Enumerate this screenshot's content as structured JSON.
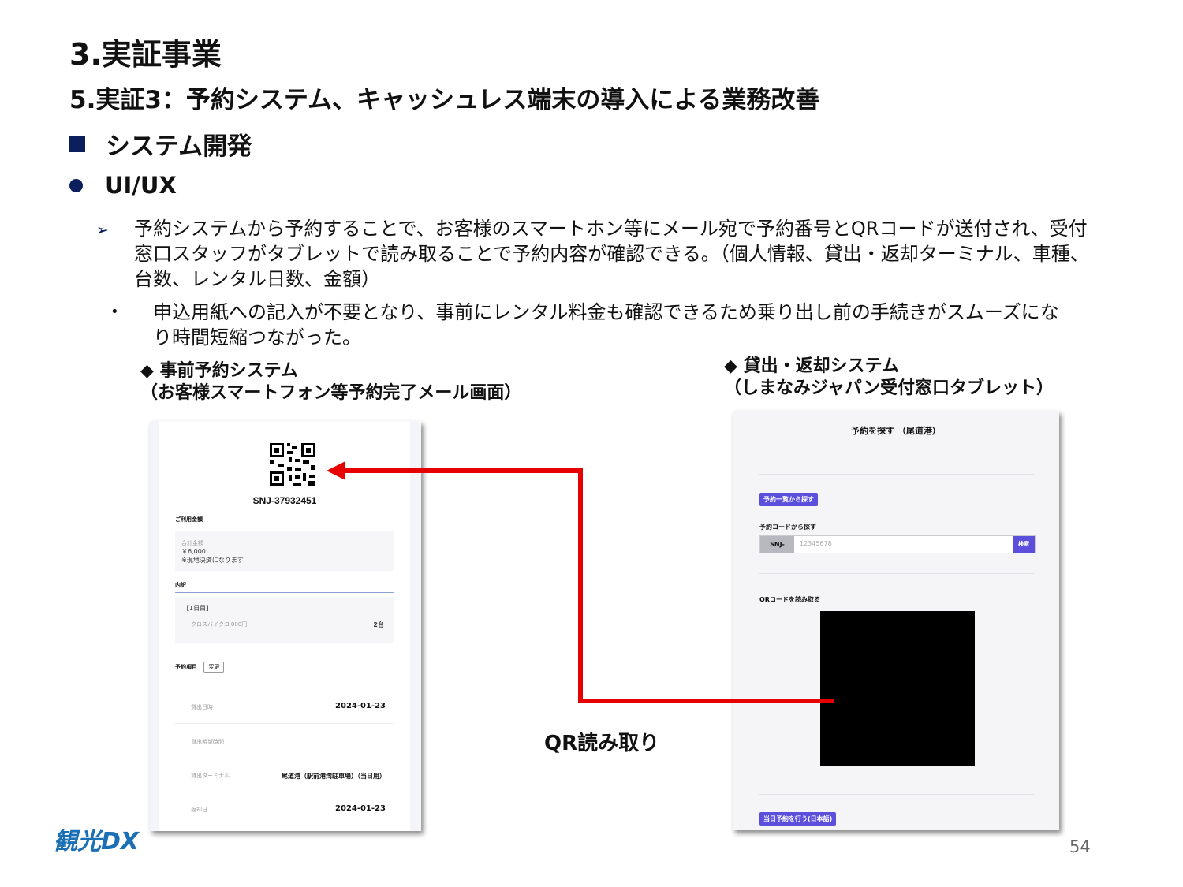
{
  "heading1": "3.実証事業",
  "heading2": "5.実証3：予約システム、キャッシュレス端末の導入による業務改善",
  "heading3": "システム開発",
  "heading4": "UI/UX",
  "bullet1": "予約システムから予約することで、お客様のスマートホン等にメール宛で予約番号とQRコードが送付され、受付\n窓口スタッフがタブレットで読み取ることで予約内容が確認できる。（個人情報、貸出・返却ターミナル、車種、\n台数、レンタル日数、金額）",
  "bullet2": "申込用紙への記入が不要となり、事前にレンタル料金も確認できるため乗り出し前の手続きがスムーズにな\nり時間短縮つながった。",
  "left_caption": "◆ 事前予約システム\n（お客様スマートフォン等予約完了メール画面）",
  "right_caption": "◆ 貸出・返却システム\n（しまなみジャパン受付窓口タブレット）",
  "phone": {
    "booking_code": "SNJ-37932451",
    "usage_heading": "ご利用金額",
    "total_label": "合計金額",
    "total_value": "￥6,000",
    "payment_note": "※現地決済になります",
    "breakdown_heading": "内訳",
    "day_label": "【1日目】",
    "item_label": "クロスバイク:3,000円",
    "item_qty": "2台",
    "items_heading": "予約項目",
    "change_button": "変更",
    "rows": [
      {
        "label": "貸出日時",
        "value": "2024-01-23"
      },
      {
        "label": "貸出希望時間",
        "value": ""
      },
      {
        "label": "貸出ターミナル",
        "value": "尾道港（駅前港湾駐車場）（当日用）"
      },
      {
        "label": "返却日",
        "value": "2024-01-23"
      }
    ]
  },
  "tablet": {
    "title": "予約を探す （尾道港）",
    "list_button": "予約一覧から探す",
    "code_label": "予約コードから探す",
    "code_prefix": "SNJ-",
    "code_placeholder": "12345678",
    "search_button": "検索",
    "qr_label": "QRコードを読み取る",
    "sameday_button": "当日予約を行う(日本語)"
  },
  "qr_read_label": "QR読み取り",
  "page_number": "54",
  "logo_text": "観光DX",
  "colors": {
    "heading_marker": "#0a1f5c",
    "arrow": "#e60000",
    "tablet_button": "#5b4fdc",
    "logo_blue": "#1a6fb5",
    "logo_green": "#3a9a3a"
  }
}
